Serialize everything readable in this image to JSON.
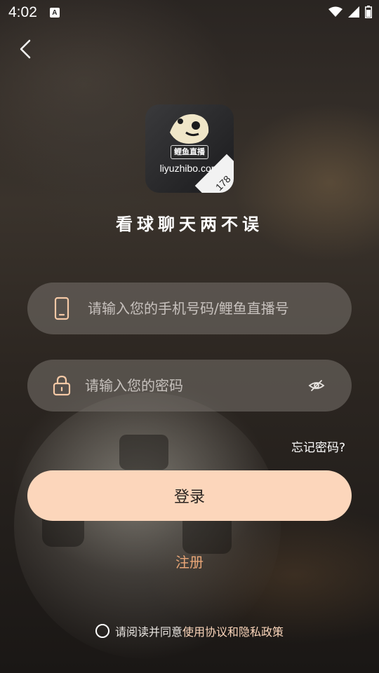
{
  "status_bar": {
    "time": "4:02",
    "notification_icon": "A"
  },
  "app": {
    "logo_url_text": "liyuzhibo.com",
    "logo_name_text": "鲤鱼直播",
    "logo_badge": "178",
    "slogan": "看球聊天两不误"
  },
  "form": {
    "phone_placeholder": "请输入您的手机号码/鲤鱼直播号",
    "phone_value": "",
    "password_placeholder": "请输入您的密码",
    "password_value": "",
    "forgot_label": "忘记密码?",
    "login_label": "登录",
    "register_label": "注册"
  },
  "agreement": {
    "prefix": "请阅读并同意",
    "terms_link": "使用协议",
    "conjunction": "和",
    "privacy_link": "隐私政策"
  },
  "colors": {
    "accent": "#fcd6bb",
    "register_text": "#e9a677",
    "field_bg": "#78736e"
  },
  "icons": [
    "back-icon",
    "phone-icon",
    "lock-icon",
    "eye-off-icon",
    "wifi-icon",
    "signal-icon",
    "battery-icon"
  ]
}
